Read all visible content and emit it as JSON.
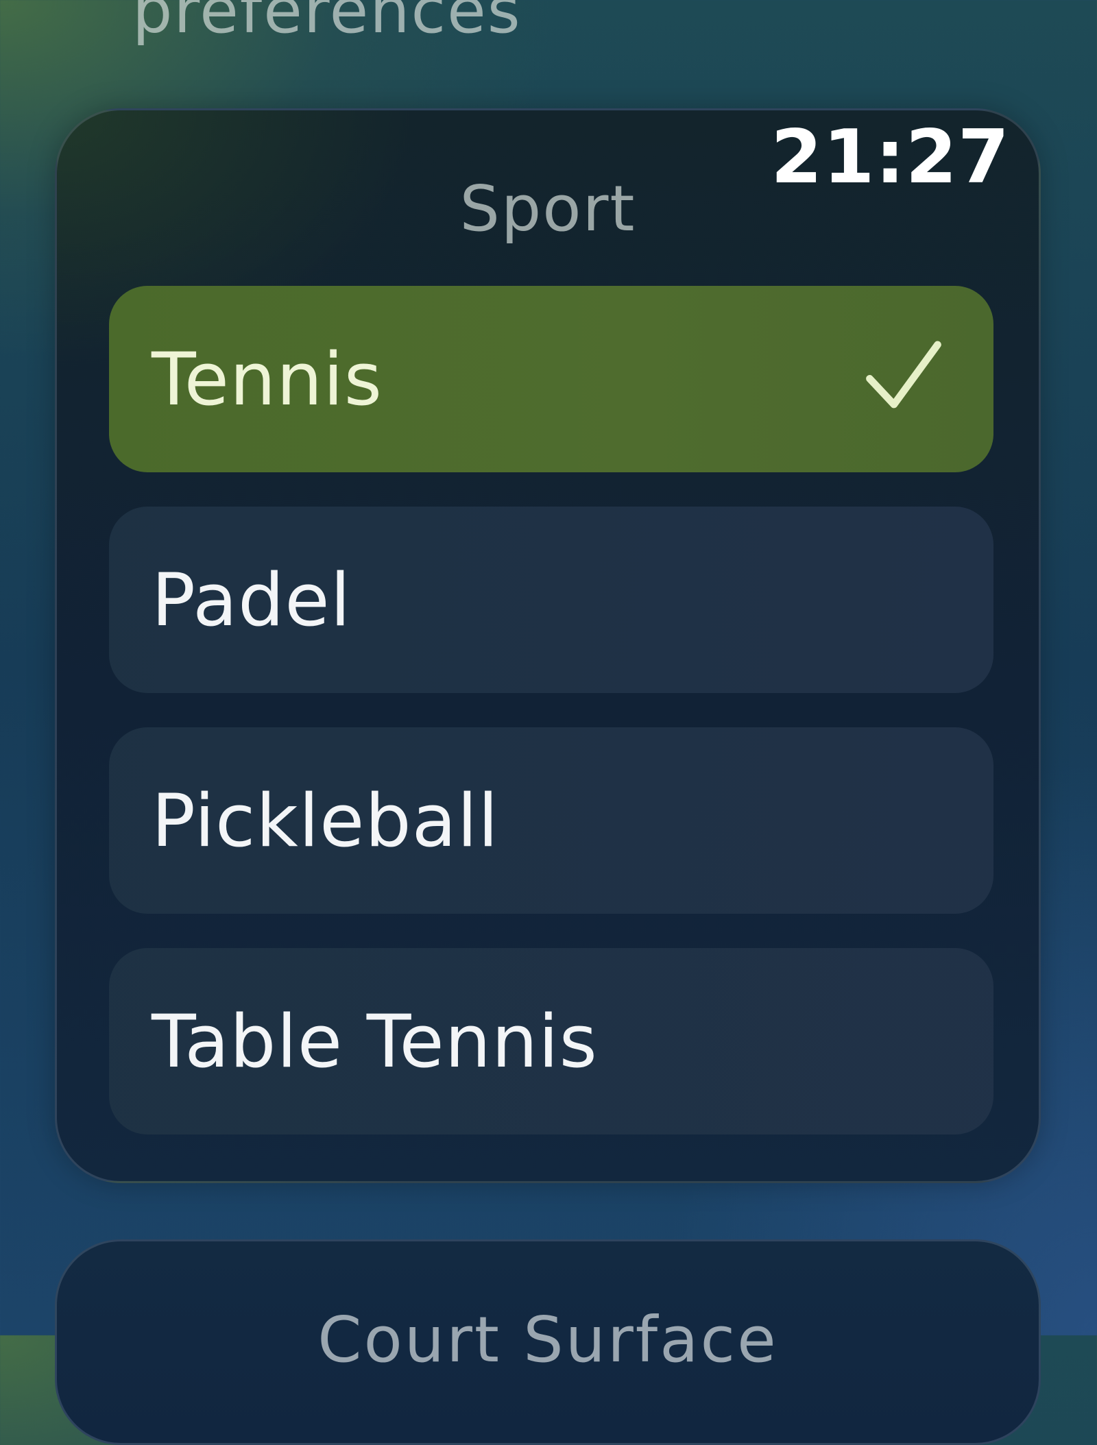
{
  "screen": {
    "title": "preferences"
  },
  "status": {
    "time": "21:27"
  },
  "sport_section": {
    "label": "Sport",
    "selected": "Tennis",
    "options": [
      {
        "label": "Tennis",
        "selected": true
      },
      {
        "label": "Padel",
        "selected": false
      },
      {
        "label": "Pickleball",
        "selected": false
      },
      {
        "label": "Table Tennis",
        "selected": false
      }
    ]
  },
  "court_surface_section": {
    "label": "Court Surface"
  },
  "icons": {
    "selected_marker": "checkmark-icon"
  },
  "colors": {
    "selected_option": "#4b6a2b",
    "option_background": "#1f3347",
    "card_background": "#12233a",
    "checkmark": "#e6f0c8"
  }
}
